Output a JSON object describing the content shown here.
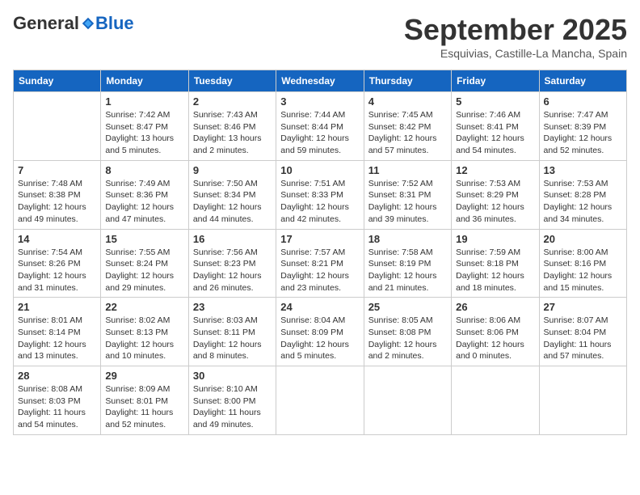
{
  "header": {
    "logo": {
      "general": "General",
      "blue": "Blue"
    },
    "title": "September 2025",
    "location": "Esquivias, Castille-La Mancha, Spain"
  },
  "calendar": {
    "weekdays": [
      "Sunday",
      "Monday",
      "Tuesday",
      "Wednesday",
      "Thursday",
      "Friday",
      "Saturday"
    ],
    "weeks": [
      [
        {
          "day": "",
          "empty": true
        },
        {
          "day": "1",
          "sunrise": "Sunrise: 7:42 AM",
          "sunset": "Sunset: 8:47 PM",
          "daylight": "Daylight: 13 hours and 5 minutes."
        },
        {
          "day": "2",
          "sunrise": "Sunrise: 7:43 AM",
          "sunset": "Sunset: 8:46 PM",
          "daylight": "Daylight: 13 hours and 2 minutes."
        },
        {
          "day": "3",
          "sunrise": "Sunrise: 7:44 AM",
          "sunset": "Sunset: 8:44 PM",
          "daylight": "Daylight: 12 hours and 59 minutes."
        },
        {
          "day": "4",
          "sunrise": "Sunrise: 7:45 AM",
          "sunset": "Sunset: 8:42 PM",
          "daylight": "Daylight: 12 hours and 57 minutes."
        },
        {
          "day": "5",
          "sunrise": "Sunrise: 7:46 AM",
          "sunset": "Sunset: 8:41 PM",
          "daylight": "Daylight: 12 hours and 54 minutes."
        },
        {
          "day": "6",
          "sunrise": "Sunrise: 7:47 AM",
          "sunset": "Sunset: 8:39 PM",
          "daylight": "Daylight: 12 hours and 52 minutes."
        }
      ],
      [
        {
          "day": "7",
          "sunrise": "Sunrise: 7:48 AM",
          "sunset": "Sunset: 8:38 PM",
          "daylight": "Daylight: 12 hours and 49 minutes."
        },
        {
          "day": "8",
          "sunrise": "Sunrise: 7:49 AM",
          "sunset": "Sunset: 8:36 PM",
          "daylight": "Daylight: 12 hours and 47 minutes."
        },
        {
          "day": "9",
          "sunrise": "Sunrise: 7:50 AM",
          "sunset": "Sunset: 8:34 PM",
          "daylight": "Daylight: 12 hours and 44 minutes."
        },
        {
          "day": "10",
          "sunrise": "Sunrise: 7:51 AM",
          "sunset": "Sunset: 8:33 PM",
          "daylight": "Daylight: 12 hours and 42 minutes."
        },
        {
          "day": "11",
          "sunrise": "Sunrise: 7:52 AM",
          "sunset": "Sunset: 8:31 PM",
          "daylight": "Daylight: 12 hours and 39 minutes."
        },
        {
          "day": "12",
          "sunrise": "Sunrise: 7:53 AM",
          "sunset": "Sunset: 8:29 PM",
          "daylight": "Daylight: 12 hours and 36 minutes."
        },
        {
          "day": "13",
          "sunrise": "Sunrise: 7:53 AM",
          "sunset": "Sunset: 8:28 PM",
          "daylight": "Daylight: 12 hours and 34 minutes."
        }
      ],
      [
        {
          "day": "14",
          "sunrise": "Sunrise: 7:54 AM",
          "sunset": "Sunset: 8:26 PM",
          "daylight": "Daylight: 12 hours and 31 minutes."
        },
        {
          "day": "15",
          "sunrise": "Sunrise: 7:55 AM",
          "sunset": "Sunset: 8:24 PM",
          "daylight": "Daylight: 12 hours and 29 minutes."
        },
        {
          "day": "16",
          "sunrise": "Sunrise: 7:56 AM",
          "sunset": "Sunset: 8:23 PM",
          "daylight": "Daylight: 12 hours and 26 minutes."
        },
        {
          "day": "17",
          "sunrise": "Sunrise: 7:57 AM",
          "sunset": "Sunset: 8:21 PM",
          "daylight": "Daylight: 12 hours and 23 minutes."
        },
        {
          "day": "18",
          "sunrise": "Sunrise: 7:58 AM",
          "sunset": "Sunset: 8:19 PM",
          "daylight": "Daylight: 12 hours and 21 minutes."
        },
        {
          "day": "19",
          "sunrise": "Sunrise: 7:59 AM",
          "sunset": "Sunset: 8:18 PM",
          "daylight": "Daylight: 12 hours and 18 minutes."
        },
        {
          "day": "20",
          "sunrise": "Sunrise: 8:00 AM",
          "sunset": "Sunset: 8:16 PM",
          "daylight": "Daylight: 12 hours and 15 minutes."
        }
      ],
      [
        {
          "day": "21",
          "sunrise": "Sunrise: 8:01 AM",
          "sunset": "Sunset: 8:14 PM",
          "daylight": "Daylight: 12 hours and 13 minutes."
        },
        {
          "day": "22",
          "sunrise": "Sunrise: 8:02 AM",
          "sunset": "Sunset: 8:13 PM",
          "daylight": "Daylight: 12 hours and 10 minutes."
        },
        {
          "day": "23",
          "sunrise": "Sunrise: 8:03 AM",
          "sunset": "Sunset: 8:11 PM",
          "daylight": "Daylight: 12 hours and 8 minutes."
        },
        {
          "day": "24",
          "sunrise": "Sunrise: 8:04 AM",
          "sunset": "Sunset: 8:09 PM",
          "daylight": "Daylight: 12 hours and 5 minutes."
        },
        {
          "day": "25",
          "sunrise": "Sunrise: 8:05 AM",
          "sunset": "Sunset: 8:08 PM",
          "daylight": "Daylight: 12 hours and 2 minutes."
        },
        {
          "day": "26",
          "sunrise": "Sunrise: 8:06 AM",
          "sunset": "Sunset: 8:06 PM",
          "daylight": "Daylight: 12 hours and 0 minutes."
        },
        {
          "day": "27",
          "sunrise": "Sunrise: 8:07 AM",
          "sunset": "Sunset: 8:04 PM",
          "daylight": "Daylight: 11 hours and 57 minutes."
        }
      ],
      [
        {
          "day": "28",
          "sunrise": "Sunrise: 8:08 AM",
          "sunset": "Sunset: 8:03 PM",
          "daylight": "Daylight: 11 hours and 54 minutes."
        },
        {
          "day": "29",
          "sunrise": "Sunrise: 8:09 AM",
          "sunset": "Sunset: 8:01 PM",
          "daylight": "Daylight: 11 hours and 52 minutes."
        },
        {
          "day": "30",
          "sunrise": "Sunrise: 8:10 AM",
          "sunset": "Sunset: 8:00 PM",
          "daylight": "Daylight: 11 hours and 49 minutes."
        },
        {
          "day": "",
          "empty": true
        },
        {
          "day": "",
          "empty": true
        },
        {
          "day": "",
          "empty": true
        },
        {
          "day": "",
          "empty": true
        }
      ]
    ]
  }
}
